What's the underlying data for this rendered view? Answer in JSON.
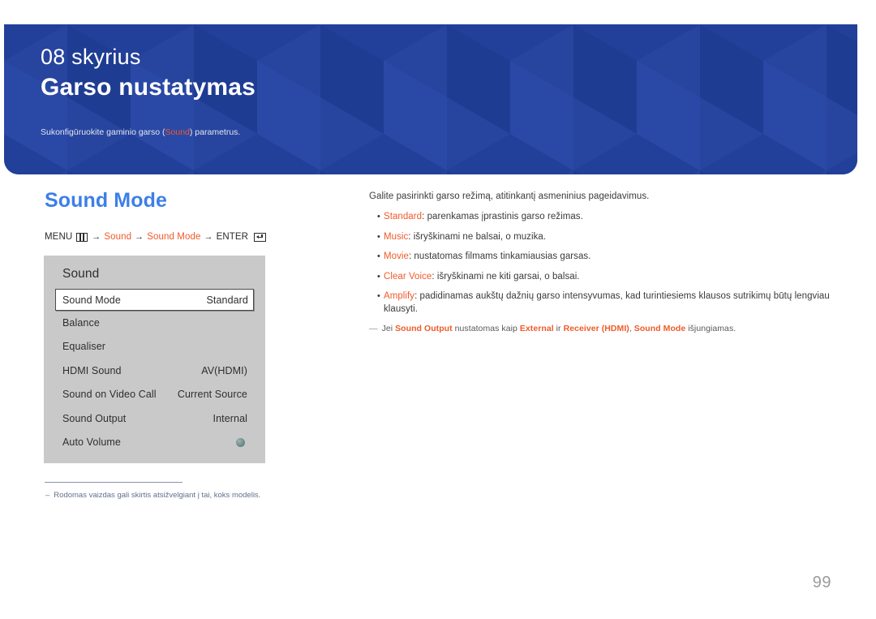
{
  "banner": {
    "chapter_number": "08 skyrius",
    "chapter_title": "Garso nustatymas",
    "subtitle_before": "Sukonfigūruokite gaminio garso (",
    "subtitle_highlight": "Sound",
    "subtitle_after": ") parametrus.",
    "background_color": "#22409a",
    "highlight_color": "#f05a28"
  },
  "section": {
    "heading": "Sound Mode",
    "heading_color": "#3d7fe8"
  },
  "breadcrumb": {
    "menu_label": "MENU",
    "menu_icon": "menu-grid-icon",
    "arrow": "→",
    "step1": "Sound",
    "step2": "Sound Mode",
    "enter_label": "ENTER",
    "enter_icon": "enter-key-icon"
  },
  "osd": {
    "title": "Sound",
    "rows": [
      {
        "label": "Sound Mode",
        "value": "Standard",
        "selected": true,
        "type": "value"
      },
      {
        "label": "Balance",
        "value": "",
        "selected": false,
        "type": "value"
      },
      {
        "label": "Equaliser",
        "value": "",
        "selected": false,
        "type": "value"
      },
      {
        "label": "HDMI Sound",
        "value": "AV(HDMI)",
        "selected": false,
        "type": "value"
      },
      {
        "label": "Sound on Video Call",
        "value": "Current Source",
        "selected": false,
        "type": "value"
      },
      {
        "label": "Sound Output",
        "value": "Internal",
        "selected": false,
        "type": "value"
      },
      {
        "label": "Auto Volume",
        "value": "",
        "selected": false,
        "type": "toggle"
      }
    ]
  },
  "left_footnote": {
    "dash": "–",
    "text": "Rodomas vaizdas gali skirtis atsižvelgiant į tai, koks modelis."
  },
  "right": {
    "intro": "Galite pasirinkti garso režimą, atitinkantį asmeninius pageidavimus.",
    "bullets": [
      {
        "dot": "•",
        "term": "Standard",
        "rest": ": parenkamas įprastinis garso režimas."
      },
      {
        "dot": "•",
        "term": "Music",
        "rest": ": išryškinami ne balsai, o muzika."
      },
      {
        "dot": "•",
        "term": "Movie",
        "rest": ": nustatomas filmams tinkamiausias garsas."
      },
      {
        "dot": "•",
        "term": "Clear Voice",
        "rest": ": išryškinami ne kiti garsai, o balsai."
      },
      {
        "dot": "•",
        "term": "Amplify",
        "rest": ": padidinamas aukštų dažnių garso intensyvumas, kad turintiesiems klausos sutrikimų būtų lengviau klausyti."
      }
    ],
    "note": {
      "dash": "―",
      "p1": "Jei ",
      "t1": "Sound Output",
      "p2": " nustatomas kaip ",
      "t2": "External",
      "p3": " ir ",
      "t3": "Receiver (HDMI)",
      "p4": ", ",
      "t4": "Sound Mode",
      "p5": " išjungiamas."
    }
  },
  "page_number": "99"
}
